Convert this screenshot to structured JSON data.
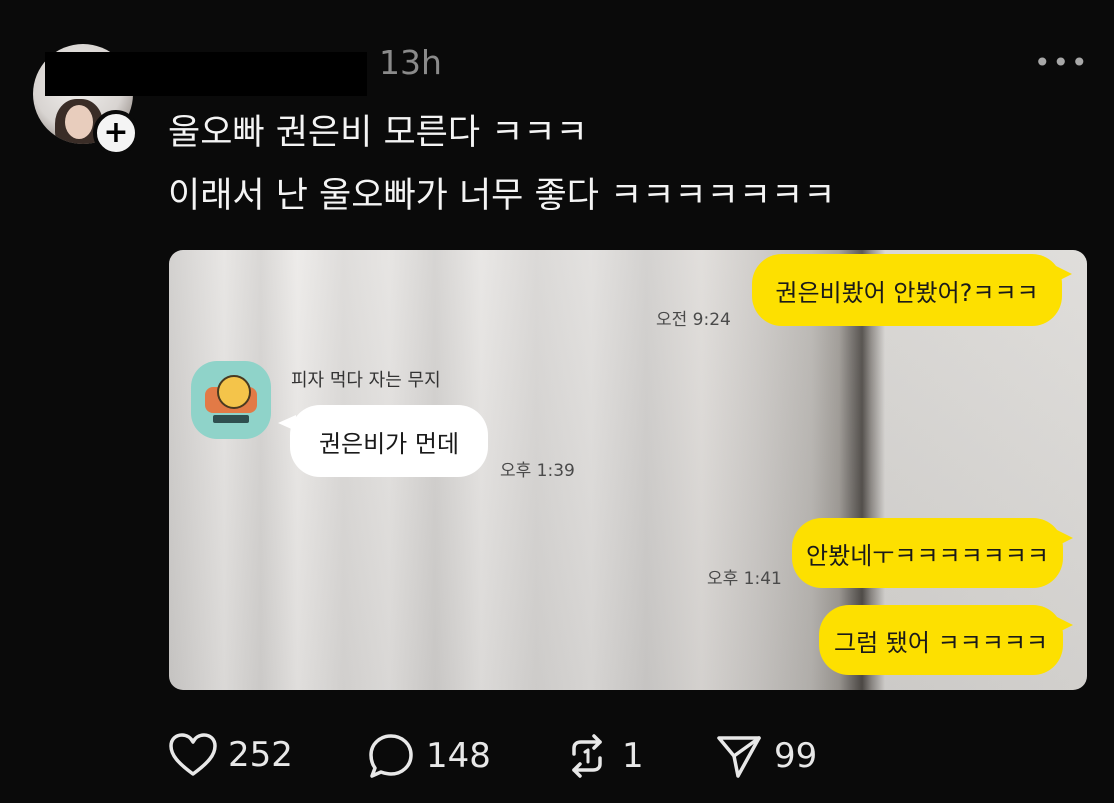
{
  "post": {
    "time": "13h",
    "more_icon": "more-horizontal-icon",
    "caption_line1": "울오빠 권은비 모른다 ㅋㅋㅋ",
    "caption_line2": "이래서 난 울오빠가 너무 좋다 ㅋㅋㅋㅋㅋㅋㅋ",
    "follow_icon": "plus-icon"
  },
  "chat": {
    "sender_name": "피자 먹다 자는 무지",
    "messages": [
      {
        "side": "right",
        "text": "권은비봤어 안봤어?ㅋㅋㅋ",
        "time": "오전 9:24"
      },
      {
        "side": "left",
        "text": "권은비가 먼데",
        "time": "오후 1:39"
      },
      {
        "side": "right",
        "text": "안봤네ㅜㅋㅋㅋㅋㅋㅋㅋ",
        "time": "오후 1:41"
      },
      {
        "side": "right",
        "text": "그럼 됐어 ㅋㅋㅋㅋㅋ",
        "time": ""
      }
    ],
    "bubble_colors": {
      "mine": "#fde000",
      "theirs": "#ffffff"
    }
  },
  "actions": {
    "likes": "252",
    "comments": "148",
    "reposts": "1",
    "shares": "99"
  }
}
